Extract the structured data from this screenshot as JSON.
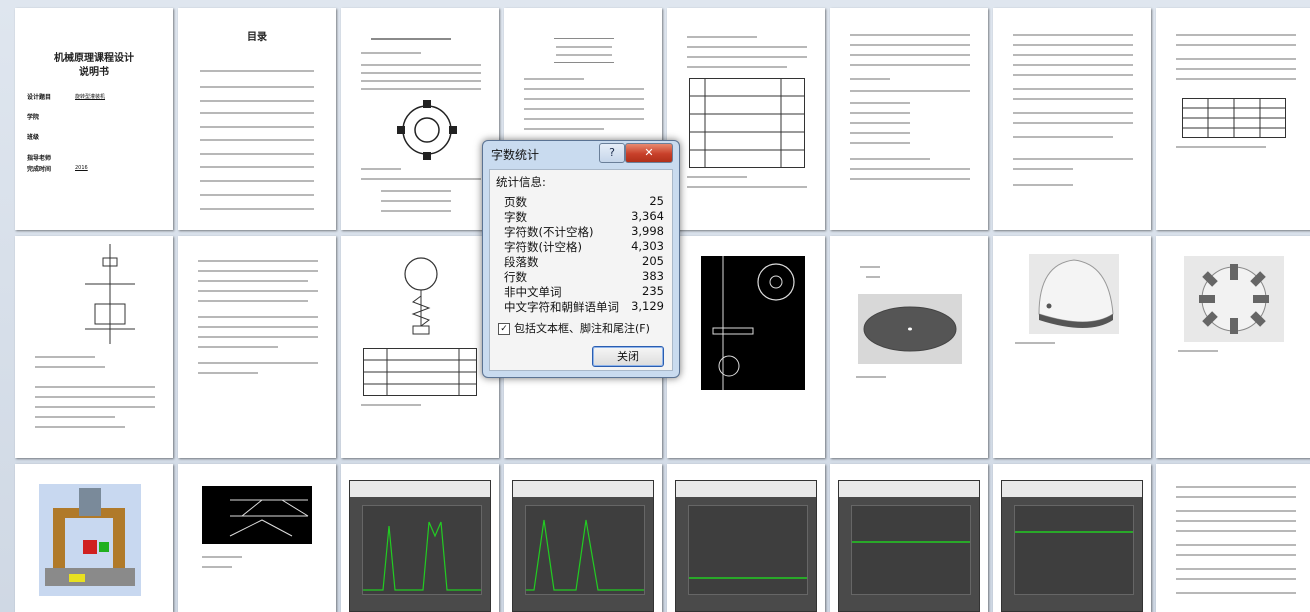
{
  "cover": {
    "title_line1": "机械原理课程设计",
    "title_line2": "说明书",
    "fields": [
      {
        "label": "设计题目",
        "value": "旋转型灌装机"
      },
      {
        "label": "学院",
        "value": ""
      },
      {
        "label": "班级",
        "value": ""
      },
      {
        "label": "指导老师",
        "value": ""
      },
      {
        "label": "完成时间",
        "value": "2016"
      }
    ]
  },
  "toc": {
    "title": "目录"
  },
  "dialog": {
    "title": "字数统计",
    "help_label": "?",
    "close_x": "✕",
    "stats_header": "统计信息:",
    "stats": [
      {
        "label": "页数",
        "value": "25"
      },
      {
        "label": "字数",
        "value": "3,364"
      },
      {
        "label": "字符数(不计空格)",
        "value": "3,998"
      },
      {
        "label": "字符数(计空格)",
        "value": "4,303"
      },
      {
        "label": "段落数",
        "value": "205"
      },
      {
        "label": "行数",
        "value": "383"
      },
      {
        "label": "非中文单词",
        "value": "235"
      },
      {
        "label": "中文字符和朝鲜语单词",
        "value": "3,129"
      }
    ],
    "checkbox_label": "包括文本框、脚注和尾注(F)",
    "checkbox_mark": "✓",
    "close_button": "关闭"
  },
  "colors": {
    "dialog_frame": "#c9dbef",
    "close_red": "#c8402a",
    "plot_green": "#22cc22"
  }
}
